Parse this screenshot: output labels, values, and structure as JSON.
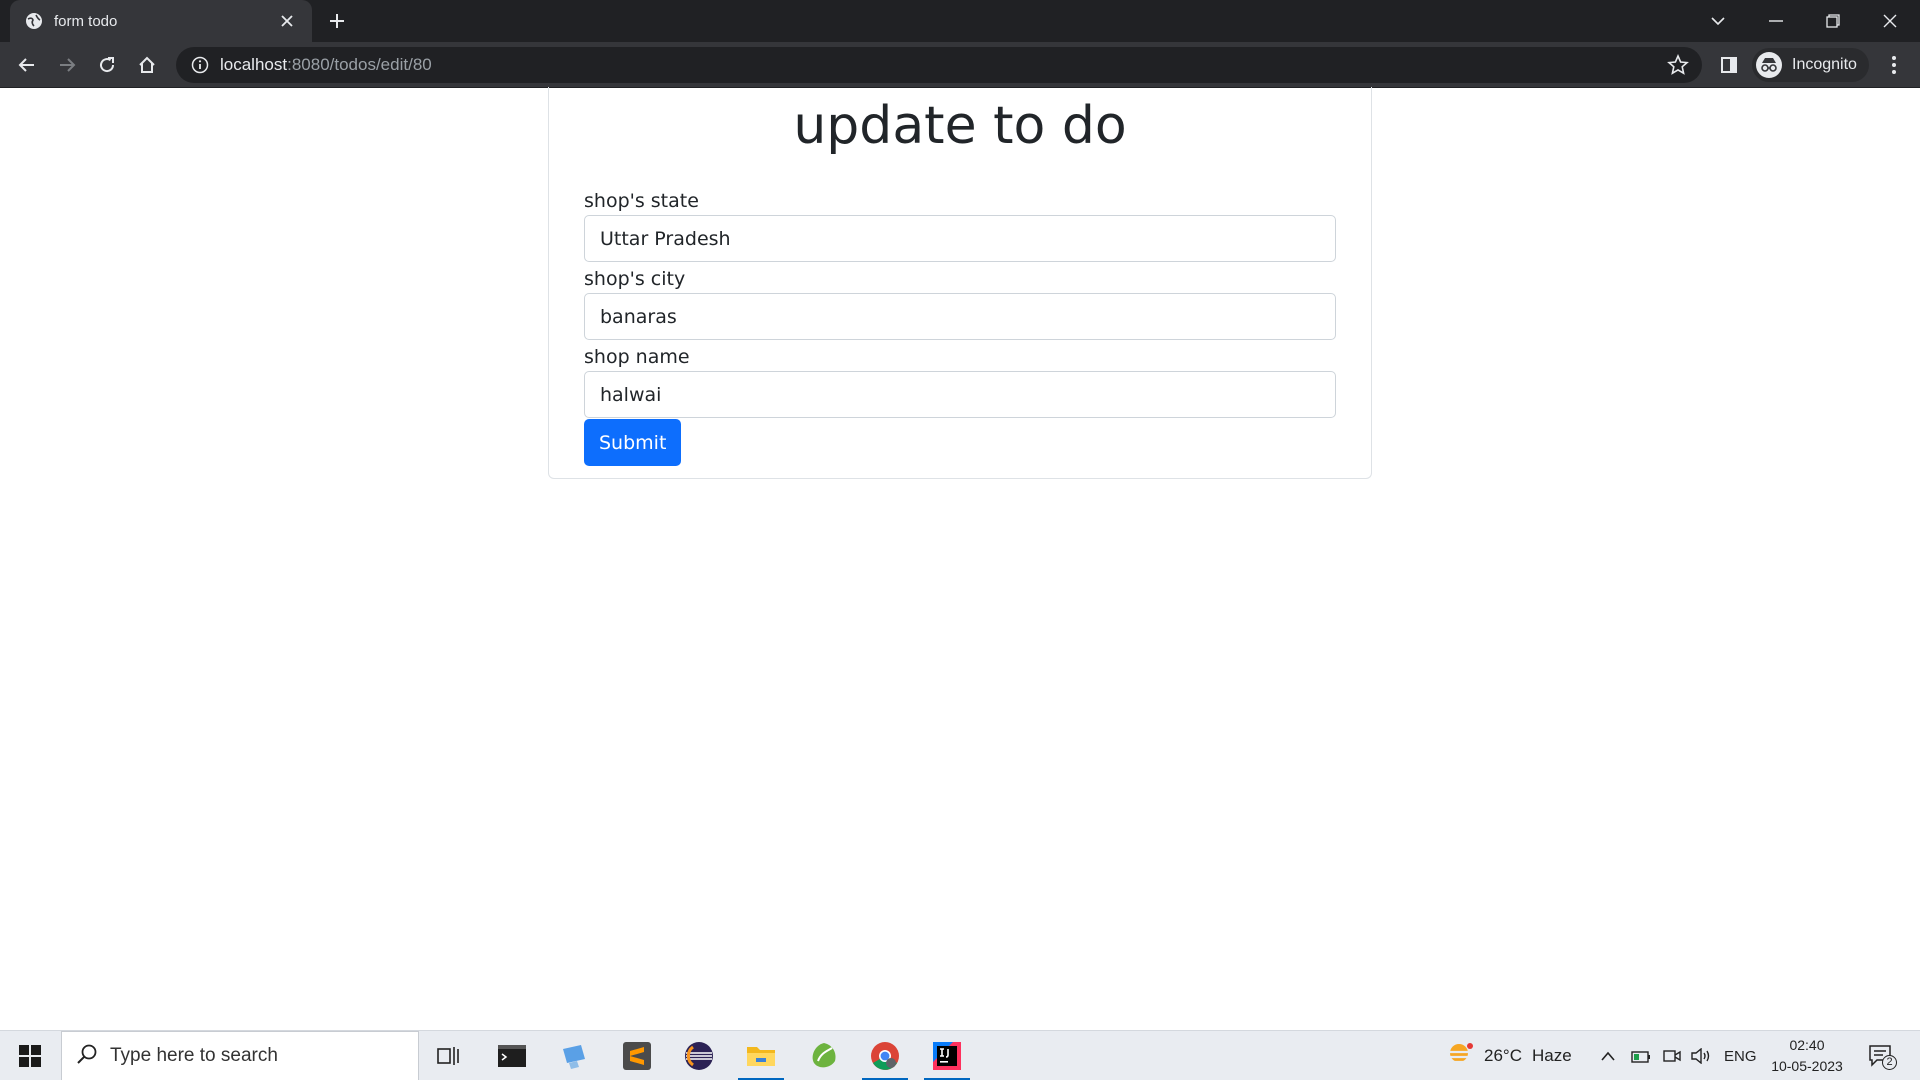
{
  "browser": {
    "tab_title": "form todo",
    "url_host": "localhost",
    "url_path": ":8080/todos/edit/80",
    "profile_label": "Incognito"
  },
  "page": {
    "title": "update to do",
    "fields": [
      {
        "label": "shop's state",
        "value": "Uttar Pradesh"
      },
      {
        "label": "shop's city",
        "value": "banaras"
      },
      {
        "label": "shop name",
        "value": "halwai"
      }
    ],
    "submit_label": "Submit"
  },
  "taskbar": {
    "search_placeholder": "Type here to search",
    "weather_temp": "26°C",
    "weather_desc": "Haze",
    "language": "ENG",
    "time": "02:40",
    "date": "10-05-2023",
    "notification_count": "2"
  },
  "colors": {
    "primary": "#0d6efd",
    "chrome_dark": "#202124",
    "chrome_toolbar": "#35363a"
  }
}
